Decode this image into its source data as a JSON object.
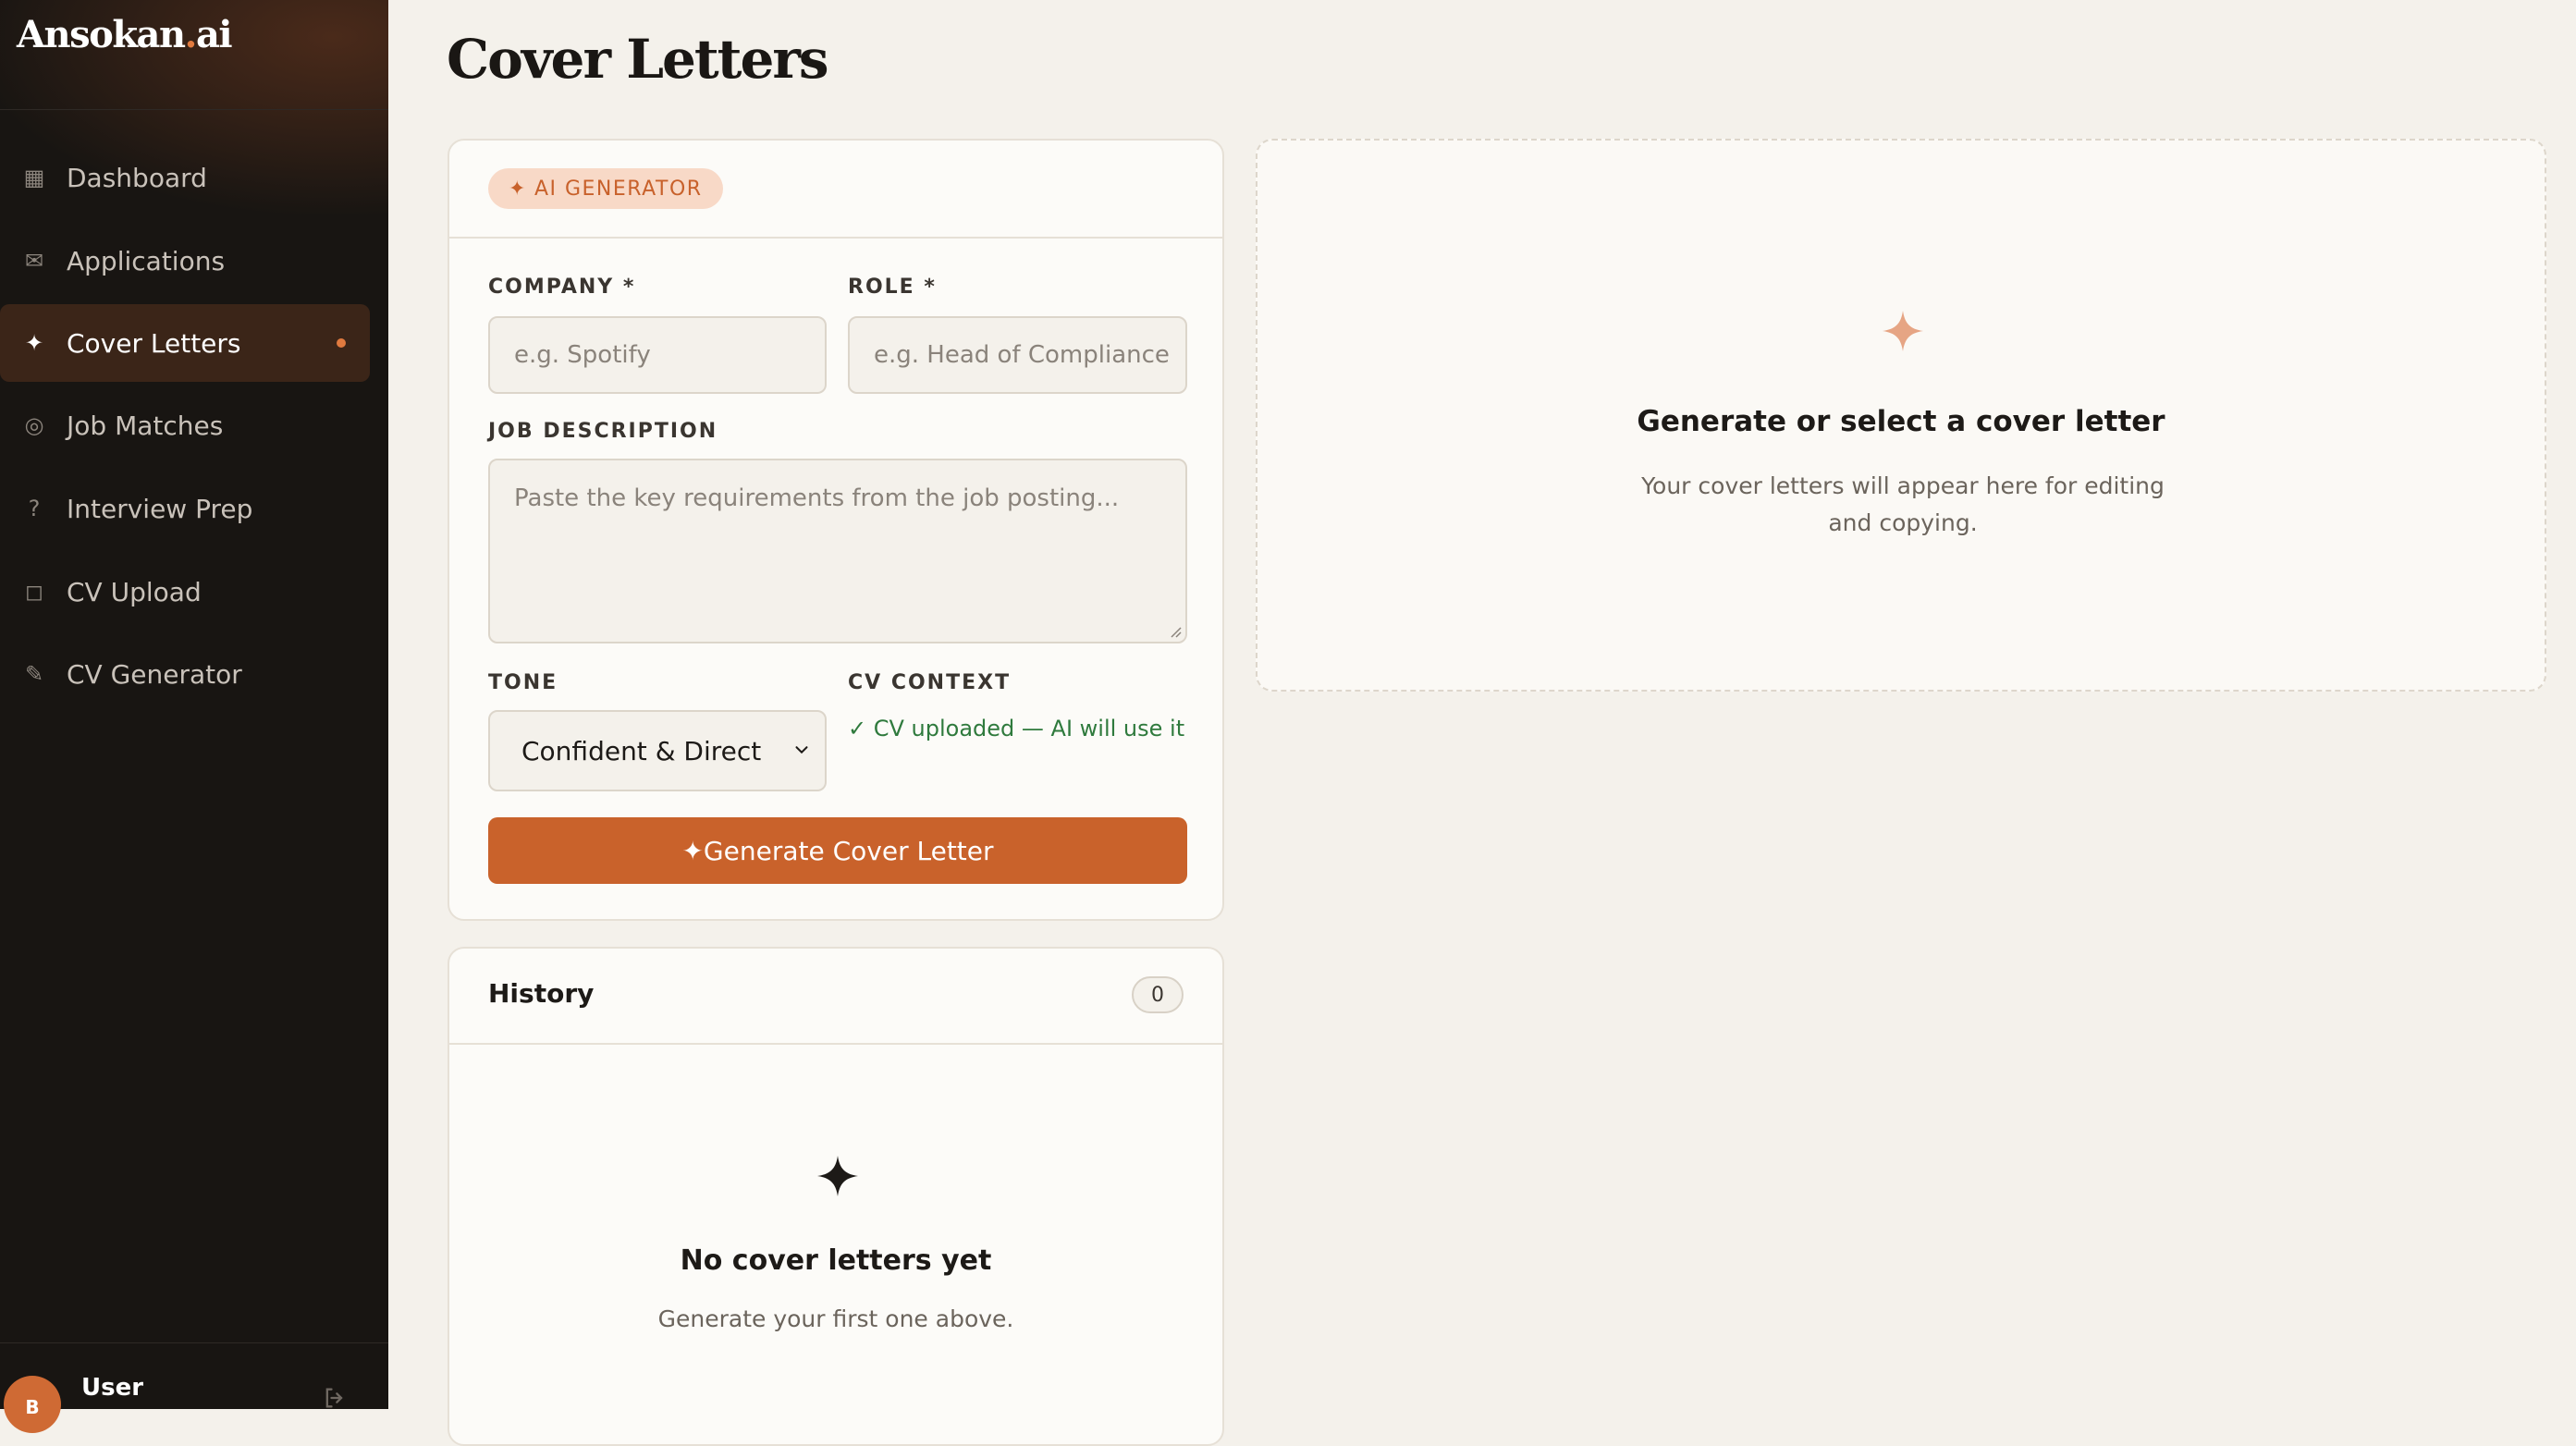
{
  "sidebar": {
    "brand": {
      "name": "Ansokan",
      "dot": ".",
      "suffix": "ai"
    },
    "items": [
      {
        "label": "Dashboard",
        "icon": "▦"
      },
      {
        "label": "Applications",
        "icon": "✉"
      },
      {
        "label": "Cover Letters",
        "icon": "✦",
        "active": true
      },
      {
        "label": "Job Matches",
        "icon": "◎"
      },
      {
        "label": "Interview Prep",
        "icon": "?"
      },
      {
        "label": "CV Upload",
        "icon": "◻"
      },
      {
        "label": "CV Generator",
        "icon": "✎"
      }
    ],
    "user": {
      "initial": "B",
      "name": "User"
    }
  },
  "page": {
    "title": "Cover Letters"
  },
  "generator": {
    "badge": "AI GENERATOR",
    "company_label": "COMPANY *",
    "company_placeholder": "e.g. Spotify",
    "role_label": "ROLE *",
    "role_placeholder": "e.g. Head of Compliance",
    "job_description_label": "JOB DESCRIPTION",
    "job_description_placeholder": "Paste the key requirements from the job posting...",
    "tone_label": "TONE",
    "tone_value": "Confident & Direct",
    "cv_context_label": "CV CONTEXT",
    "cv_context_status": "✓ CV uploaded — AI will use it",
    "button_label": "✦Generate Cover Letter"
  },
  "history": {
    "title": "History",
    "count": "0",
    "empty_title": "No cover letters yet",
    "empty_subtitle": "Generate your first one above."
  },
  "preview": {
    "title": "Generate or select a cover letter",
    "subtitle": "Your cover letters will appear here for editing and copying."
  },
  "colors": {
    "accent": "#c9622b",
    "sidebar_bg": "#181512",
    "page_bg": "#f4f1eb",
    "success": "#2f7a3d"
  }
}
